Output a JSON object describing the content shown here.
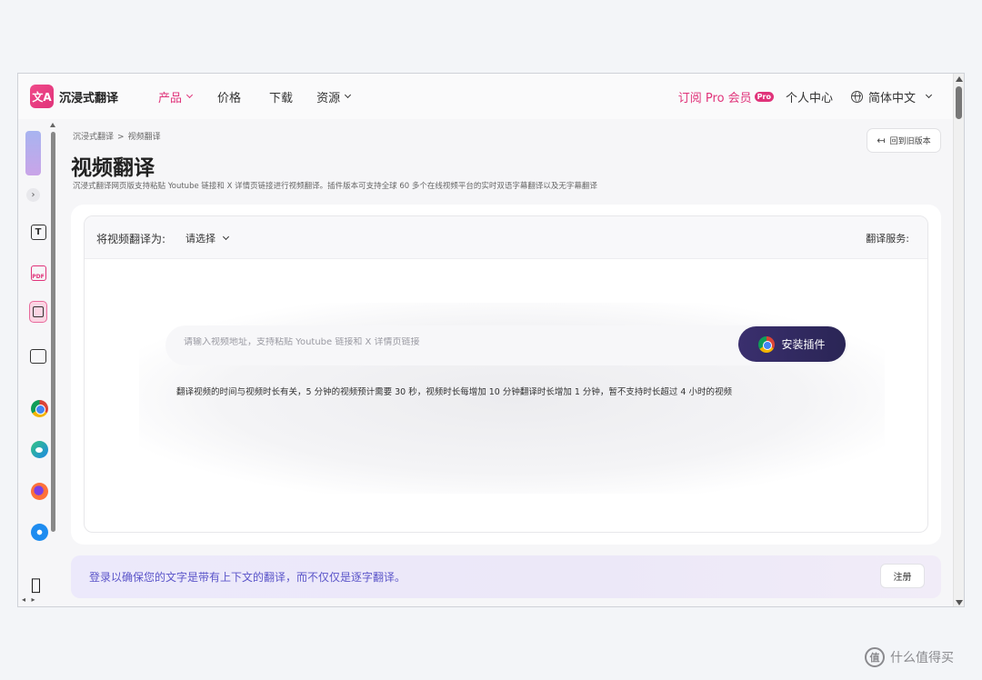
{
  "nav": {
    "logo_text": "沉浸式翻译",
    "items": [
      {
        "label": "产品",
        "dropdown": true,
        "active": true
      },
      {
        "label": "价格",
        "dropdown": false,
        "active": false
      },
      {
        "label": "下载",
        "dropdown": false,
        "active": false
      },
      {
        "label": "资源",
        "dropdown": true,
        "active": false
      }
    ],
    "subscribe_label": "订阅 Pro 会员",
    "pro_badge": "Pro",
    "user_center": "个人中心",
    "language": "简体中文"
  },
  "dock": {
    "tools": [
      "text-translate-icon",
      "pdf-translate-icon",
      "video-translate-icon",
      "image-translate-icon"
    ],
    "browsers": [
      "chrome-icon",
      "edge-icon",
      "firefox-icon",
      "safari-icon"
    ],
    "os": "apple-icon"
  },
  "breadcrumb": [
    "沉浸式翻译",
    "视频翻译"
  ],
  "breadcrumb_sep": ">",
  "back_button": "回到旧版本",
  "page": {
    "title": "视频翻译",
    "description": "沉浸式翻译网页版支持粘贴 Youtube 链接和 X 详情页链接进行视频翻译。插件版本可支持全球 60 多个在线视频平台的实时双语字幕翻译以及无字幕翻译"
  },
  "translator": {
    "target_label": "将视频翻译为:",
    "target_value": "请选择",
    "service_label": "翻译服务:",
    "url_placeholder": "请输入视频地址，支持粘贴 Youtube 链接和 X 详情页链接",
    "install_button": "安装插件",
    "hint": "翻译视频的时间与视频时长有关，5 分钟的视频预计需要 30 秒，视频时长每增加 10 分钟翻译时长增加 1 分钟，暂不支持时长超过 4 小时的视频"
  },
  "login_bar": {
    "text": "登录以确保您的文字是带有上下文的翻译，而不仅仅是逐字翻译。",
    "signup": "注册"
  },
  "watermark": {
    "icon_text": "值",
    "text": "什么值得买"
  },
  "colors": {
    "brand": "#e0337a",
    "install_button": "#2f2860",
    "login_text": "#5b55c9"
  }
}
